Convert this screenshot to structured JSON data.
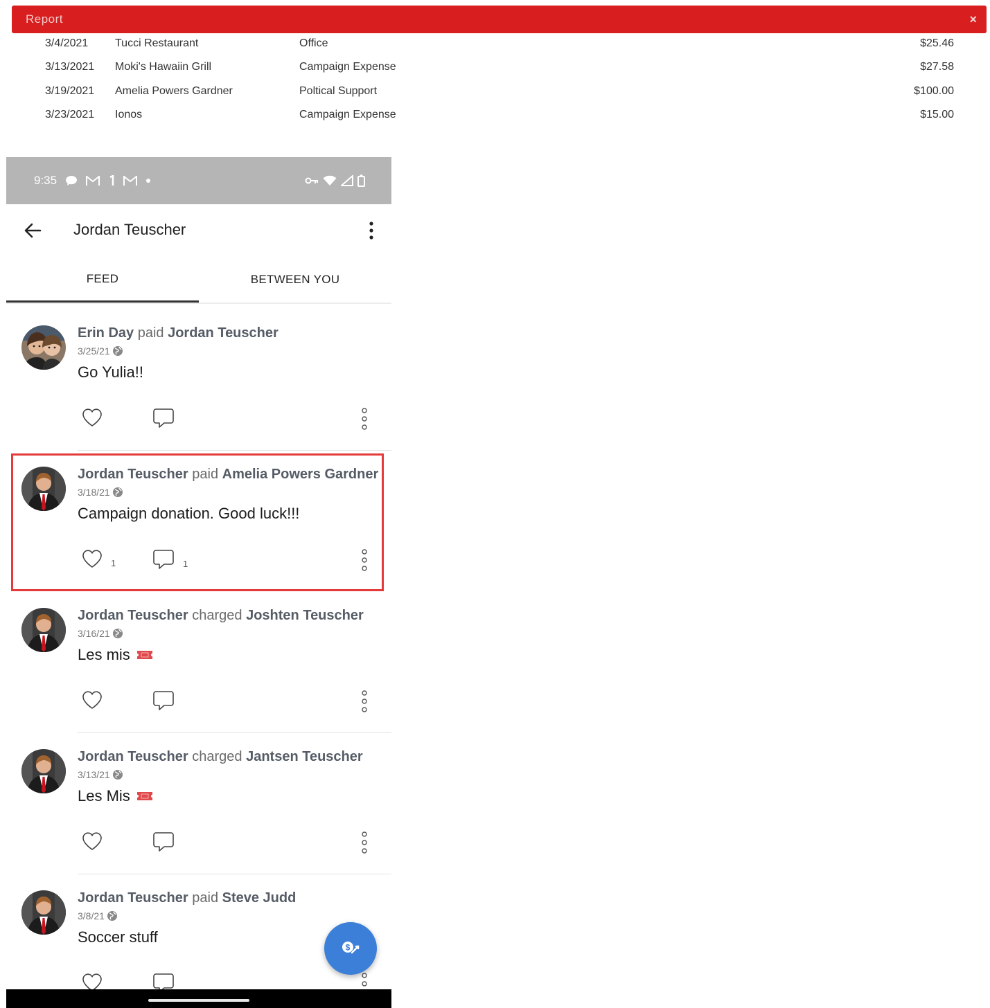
{
  "report": {
    "title": "Report",
    "close_glyph": "×",
    "accent_color": "#d81e1e",
    "rows": [
      {
        "date": "3/4/2021",
        "payee": "Tucci Restaurant",
        "category": "Office",
        "amount": "$25.46"
      },
      {
        "date": "3/13/2021",
        "payee": "Moki's Hawaiin Grill",
        "category": "Campaign Expense",
        "amount": "$27.58"
      },
      {
        "date": "3/19/2021",
        "payee": "Amelia Powers Gardner",
        "category": "Poltical Support",
        "amount": "$100.00"
      },
      {
        "date": "3/23/2021",
        "payee": "Ionos",
        "category": "Campaign Expense",
        "amount": "$15.00"
      }
    ]
  },
  "status": {
    "time": "9:35",
    "icons_left": [
      "chat-bubble-icon",
      "gmail-icon",
      "notification-icon",
      "gmail-icon",
      "dot-icon"
    ],
    "icons_right": [
      "vpn-key-icon",
      "wifi-icon",
      "cell-signal-icon",
      "battery-icon"
    ]
  },
  "appbar": {
    "title": "Jordan Teuscher",
    "back_icon": "arrow-back-icon",
    "menu_icon": "more-vert-icon"
  },
  "tabs": {
    "feed": "FEED",
    "between": "BETWEEN YOU",
    "active": "feed"
  },
  "feed": [
    {
      "actor": "Erin Day",
      "verb": "paid",
      "target": "Jordan Teuscher",
      "date": "3/25/21",
      "note": "Go Yulia!!",
      "emoji": "",
      "likes": "",
      "comments": "",
      "avatar": "avatar-two-women"
    },
    {
      "actor": "Jordan Teuscher",
      "verb": "paid",
      "target": "Amelia Powers Gardner",
      "date": "3/18/21",
      "note": "Campaign donation. Good luck!!!",
      "emoji": "",
      "likes": "1",
      "comments": "1",
      "avatar": "avatar-man-red-tie",
      "highlighted": true
    },
    {
      "actor": "Jordan Teuscher",
      "verb": "charged",
      "target": "Joshten Teuscher",
      "date": "3/16/21",
      "note": "Les mis",
      "emoji": "ticket-icon",
      "likes": "",
      "comments": "",
      "avatar": "avatar-man-red-tie"
    },
    {
      "actor": "Jordan Teuscher",
      "verb": "charged",
      "target": "Jantsen Teuscher",
      "date": "3/13/21",
      "note": "Les Mis",
      "emoji": "ticket-icon",
      "likes": "",
      "comments": "",
      "avatar": "avatar-man-red-tie"
    },
    {
      "actor": "Jordan Teuscher",
      "verb": "paid",
      "target": "Steve Judd",
      "date": "3/8/21",
      "note": "Soccer stuff",
      "emoji": "",
      "likes": "",
      "comments": "",
      "avatar": "avatar-man-red-tie"
    }
  ],
  "fab": {
    "icon": "pay-request-icon",
    "color": "#3c7fd9"
  },
  "highlight_color": "#e53a3a"
}
